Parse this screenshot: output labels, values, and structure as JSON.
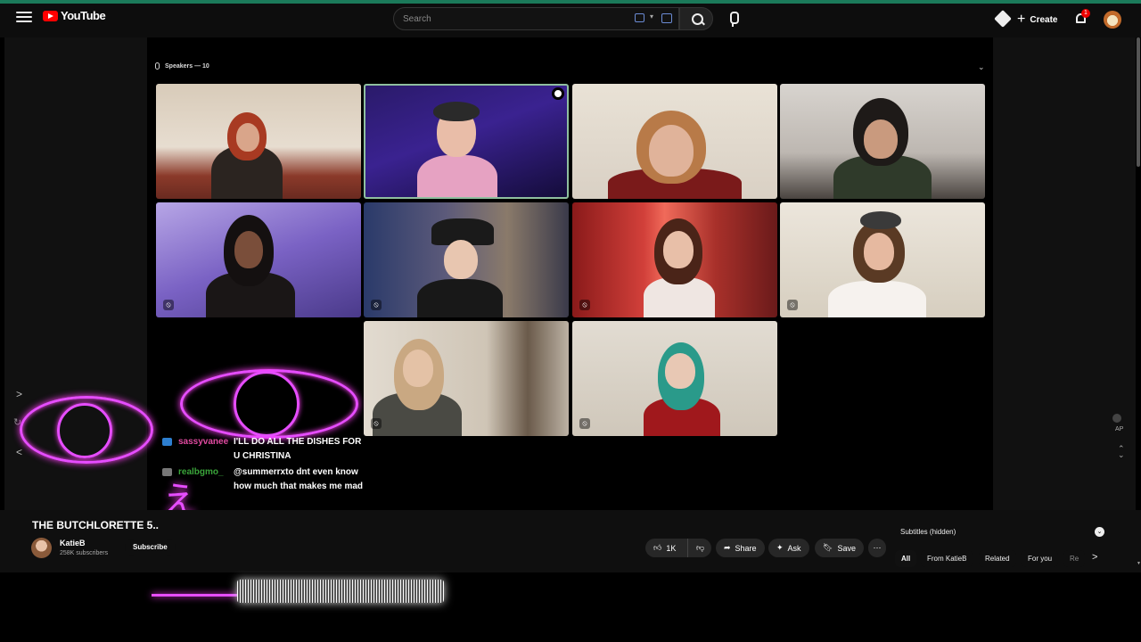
{
  "header": {
    "logo_text": "YouTube",
    "search_placeholder": "Search",
    "create_label": "Create",
    "notification_count": "1"
  },
  "stage": {
    "speakers_label": "Speakers — 10"
  },
  "chat": [
    {
      "user": "sassyvanee",
      "message": "I'LL DO ALL THE DISHES FOR U CHRISTINA"
    },
    {
      "user": "realbgmo_",
      "message": "@summerrxto dnt even know how much that makes me mad"
    }
  ],
  "video": {
    "title": "THE BUTCHLORETTE 5..",
    "channel_name": "KatieB",
    "subscribers": "258K subscribers",
    "subscribe_label": "Subscribe",
    "likes": "1K",
    "share_label": "Share",
    "ask_label": "Ask",
    "save_label": "Save"
  },
  "side_panel": {
    "subtitles_label": "Subtitles (hidden)",
    "ap_label": "AP",
    "chips": [
      "All",
      "From KatieB",
      "Related",
      "For you",
      "Re"
    ]
  },
  "icons": {
    "accent": "#1b7a5a",
    "overlay_neon": "#e64dff"
  }
}
